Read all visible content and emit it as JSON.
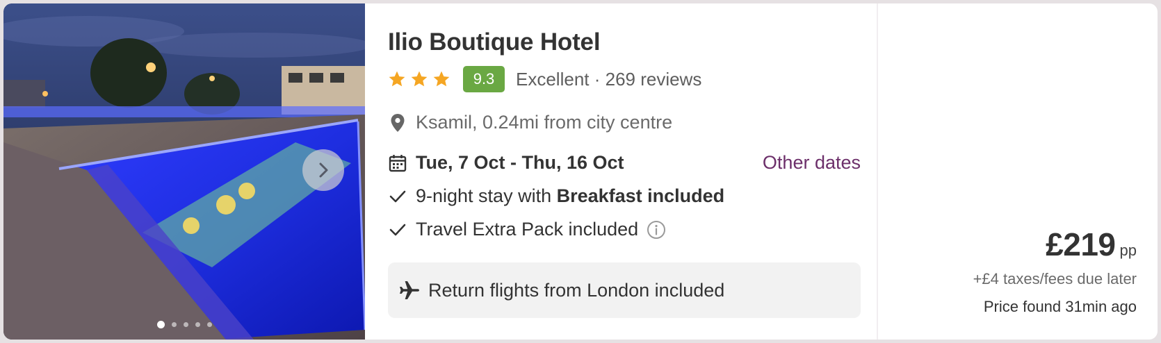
{
  "hotel": {
    "name": "Ilio Boutique Hotel",
    "stars": 3,
    "score": "9.3",
    "rating_label": "Excellent · 269 reviews",
    "location": "Ksamil, 0.24mi from city centre",
    "dates": "Tue, 7 Oct - Thu, 16 Oct",
    "other_dates_label": "Other dates",
    "stay_prefix": "9-night stay with ",
    "stay_board": "Breakfast included",
    "extra_pack": "Travel Extra Pack included",
    "flights": "Return flights from London included"
  },
  "gallery": {
    "image_count": 5,
    "active_index": 0
  },
  "price": {
    "amount": "£219",
    "unit": "pp",
    "taxes": "+£4 taxes/fees due later",
    "found": "Price found 31min ago"
  },
  "icons": {
    "star": "star-icon",
    "location": "map-pin-icon",
    "calendar": "calendar-icon",
    "check": "check-icon",
    "info": "info-icon",
    "plane": "plane-icon",
    "next": "chevron-right-icon"
  },
  "colors": {
    "star": "#f5a623",
    "score_badge": "#6aa843",
    "link": "#6c2f6a",
    "flights_bg": "#f2f2f2"
  }
}
